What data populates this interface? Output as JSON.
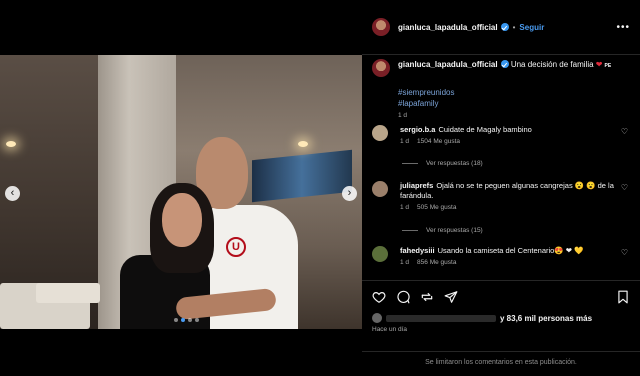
{
  "post": {
    "username": "gianluca_lapadula_official",
    "follow_label": "Seguir",
    "separator": "•",
    "more_icon": "more-horizontal-icon"
  },
  "caption": {
    "username": "gianluca_lapadula_official",
    "text": "Una decisión de familia",
    "heart": "❤",
    "flag_text": "PE",
    "hashtags": [
      "#siempreunidos",
      "#lapafamily"
    ],
    "time": "1 d"
  },
  "comments": [
    {
      "username": "sergio.b.a",
      "text": "Cuidate de Magaly bambino",
      "time": "1 d",
      "likes": "1504 Me gusta",
      "replies": "Ver respuestas (18)",
      "avatar_color": "#b9a58a"
    },
    {
      "username": "juliaprefs",
      "text": "Ojalá no se te peguen algunas cangrejas 😮 😮 de la farándula.",
      "time": "1 d",
      "likes": "505 Me gusta",
      "replies": "Ver respuestas (15)",
      "avatar_color": "#9a7f6a"
    },
    {
      "username": "fahedysiii",
      "text": "Usando la camiseta del Centenario😍 ❤ 💛",
      "time": "1 d",
      "likes": "856 Me gusta",
      "replies": "",
      "avatar_color": "#5b6f3a"
    }
  ],
  "actions": {
    "icons": [
      "heart-icon",
      "comment-icon",
      "share-icon",
      "send-icon",
      "bookmark-icon"
    ]
  },
  "likes_summary": "y 83,6 mil personas más",
  "posted_time": "Hace un día",
  "comments_limited": "Se limitaron los comentarios en esta publicación.",
  "carousel": {
    "prev": "‹",
    "next": "›",
    "total_slides": 4,
    "active_slide": 2
  },
  "photo": {
    "shirt_logo": "U"
  },
  "colors": {
    "accent_blue": "#4a9bf0",
    "verified_blue": "#3897f0",
    "heart_red": "#e02a3b",
    "hashtag": "#7aa2d6"
  }
}
